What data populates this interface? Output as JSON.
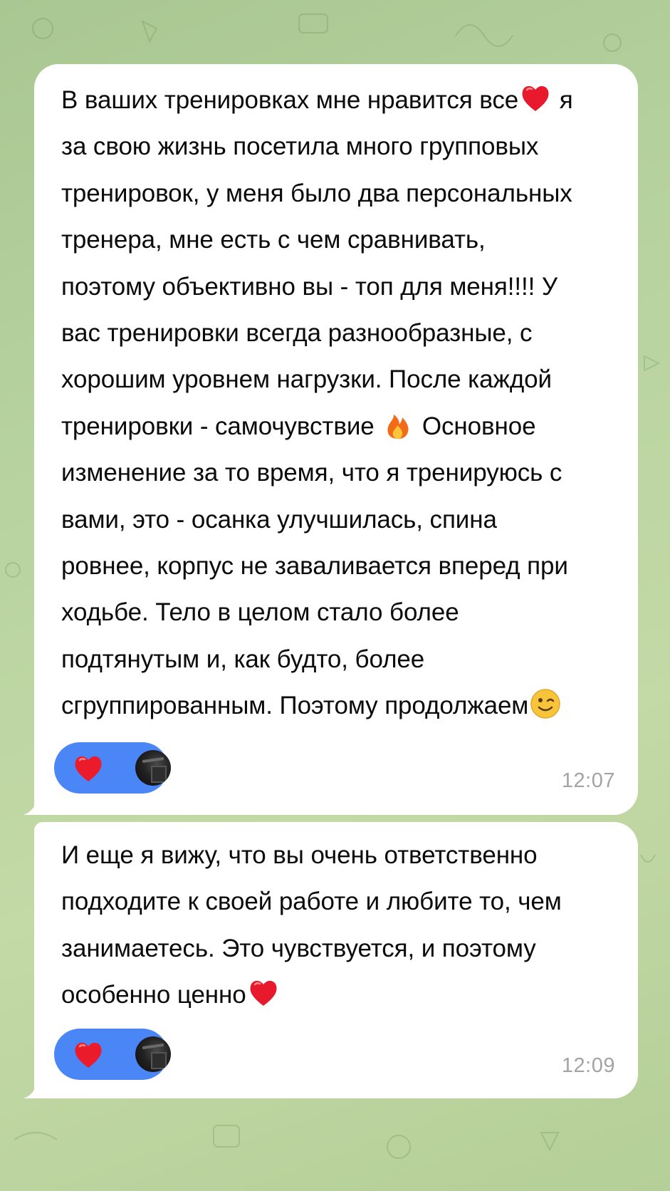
{
  "chat": {
    "background_color": "#b8d3a0",
    "messages": [
      {
        "text_parts": [
          "В ваших тренировках мне нравится все",
          " я\nза свою жизнь посетила много групповых\nтренировок, у меня было два персональных\nтренера, мне есть с чем сравнивать,\nпоэтому объективно вы - топ для меня!!!! У\nвас тренировки всегда разнообразные, с\nхорошим уровнем нагрузки. После каждой\nтренировки - самочувствие ",
          " Основное\nизменение за то время, что я тренируюсь с\nвами, это - осанка улучшилась, спина\nровнее, корпус не заваливается вперед при\nходьбе. Тело в целом стало более\nподтянутым и, как будто, более\nсгруппированным. Поэтому продолжаем"
        ],
        "emojis": [
          "red-heart",
          "fire",
          "winking-face"
        ],
        "reaction": {
          "emoji": "red-heart",
          "color": "#4a86f6"
        },
        "time": "12:07"
      },
      {
        "text_parts": [
          "И еще я вижу, что вы очень ответственно\nподходите к своей работе и любите то, чем\nзанимаетесь. Это чувствуется, и поэтому\nособенно ценно"
        ],
        "emojis": [
          "red-heart"
        ],
        "reaction": {
          "emoji": "red-heart",
          "color": "#4a86f6"
        },
        "time": "12:09"
      }
    ]
  }
}
